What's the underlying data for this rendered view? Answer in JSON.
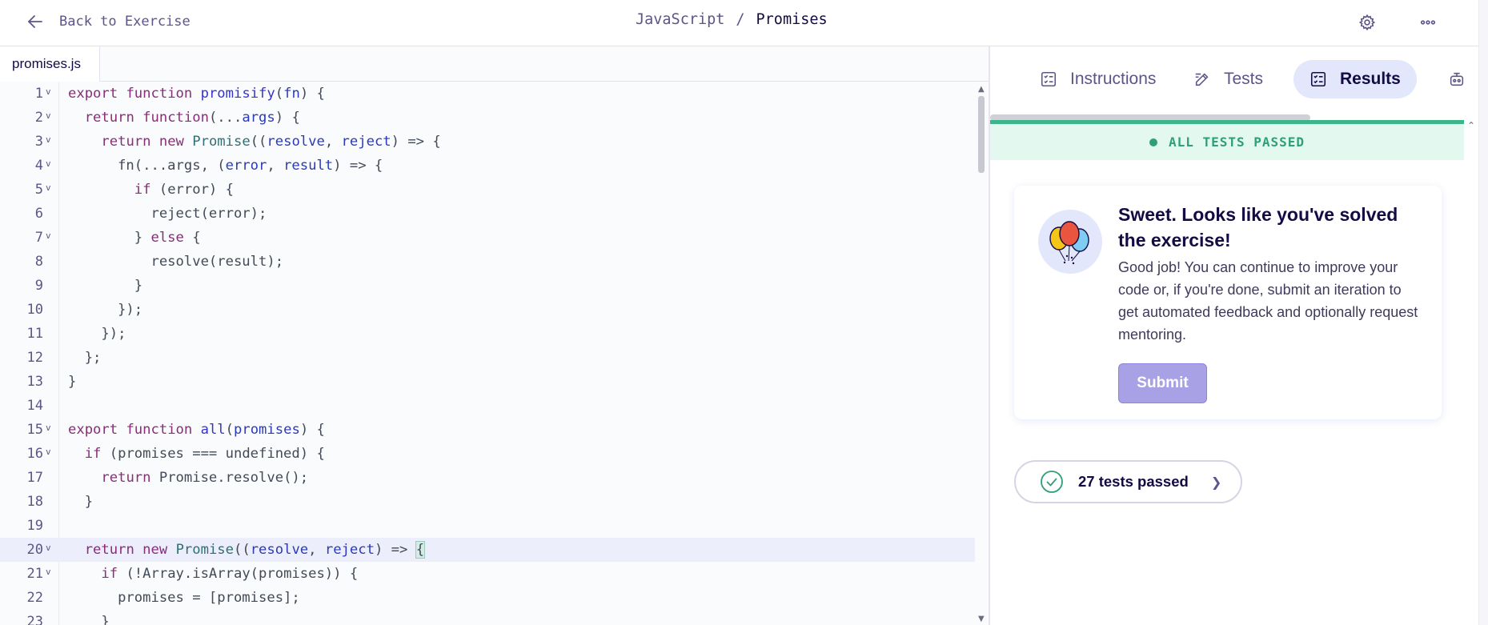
{
  "header": {
    "back_label": "Back to Exercise",
    "track": "JavaScript",
    "separator": "/",
    "exercise": "Promises"
  },
  "editor": {
    "file_tab": "promises.js",
    "lines": [
      "1",
      "2",
      "3",
      "4",
      "5",
      "6",
      "7",
      "8",
      "9",
      "10",
      "11",
      "12",
      "13",
      "14",
      "15",
      "16",
      "17",
      "18",
      "19",
      "20",
      "21",
      "22",
      "23"
    ],
    "active_line": 20
  },
  "panel": {
    "tabs": [
      {
        "label": "Instructions",
        "icon": "checklist-icon"
      },
      {
        "label": "Tests",
        "icon": "edit-icon"
      },
      {
        "label": "Results",
        "icon": "checklist-icon",
        "active": true
      },
      {
        "label": "",
        "icon": "robot-icon"
      }
    ],
    "status": "ALL TESTS PASSED",
    "card": {
      "title": "Sweet. Looks like you've solved the exercise!",
      "body": "Good job! You can continue to improve your code or, if you're done, submit an iteration to get automated feedback and optionally request mentoring.",
      "submit_label": "Submit"
    },
    "tests_passed_label": "27 tests passed"
  },
  "colors": {
    "accent": "#130b43",
    "success": "#2e9f77",
    "active_tab": "#e2e7fb",
    "submit": "#a9a1e6"
  }
}
